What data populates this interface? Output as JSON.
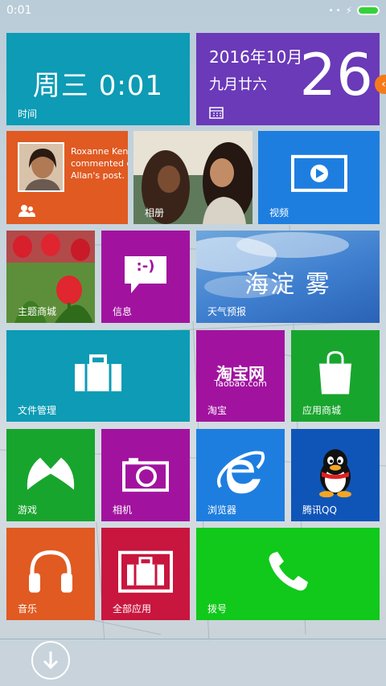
{
  "status_bar": {
    "time": "0:01"
  },
  "tiles": {
    "clock": {
      "time": "周三  0:01",
      "label": "时间"
    },
    "date": {
      "date": "2016年10月",
      "lunar": "九月廿六",
      "day": "26"
    },
    "social": {
      "line1": "Roxanne Kenis",
      "line2": "commented o",
      "line3": "Allan's post."
    },
    "photos": {
      "label": "相册"
    },
    "video": {
      "label": "视频"
    },
    "themes": {
      "label": "主题商城"
    },
    "messages": {
      "label": "信息",
      "emoticon": ":-)"
    },
    "weather": {
      "text": "海淀  雾",
      "label": "天气预报"
    },
    "files": {
      "label": "文件管理"
    },
    "taobao": {
      "logo": "淘宝网",
      "sub": "Taobao.com",
      "label": "淘宝"
    },
    "store": {
      "label": "应用商城"
    },
    "games": {
      "label": "游戏"
    },
    "camera": {
      "label": "相机"
    },
    "browser": {
      "label": "浏览器"
    },
    "qq": {
      "label": "腾讯QQ"
    },
    "music": {
      "label": "音乐"
    },
    "all_apps": {
      "label": "全部应用"
    },
    "dialer": {
      "label": "拨号"
    }
  },
  "colors": {
    "teal": "#0d9bb5",
    "purple": "#6a3ab8",
    "orange": "#e05a22",
    "blue": "#1e7ee0",
    "magenta": "#a1139f",
    "green": "#18a52e",
    "red": "#c8163e",
    "bright_green": "#10c91a"
  }
}
